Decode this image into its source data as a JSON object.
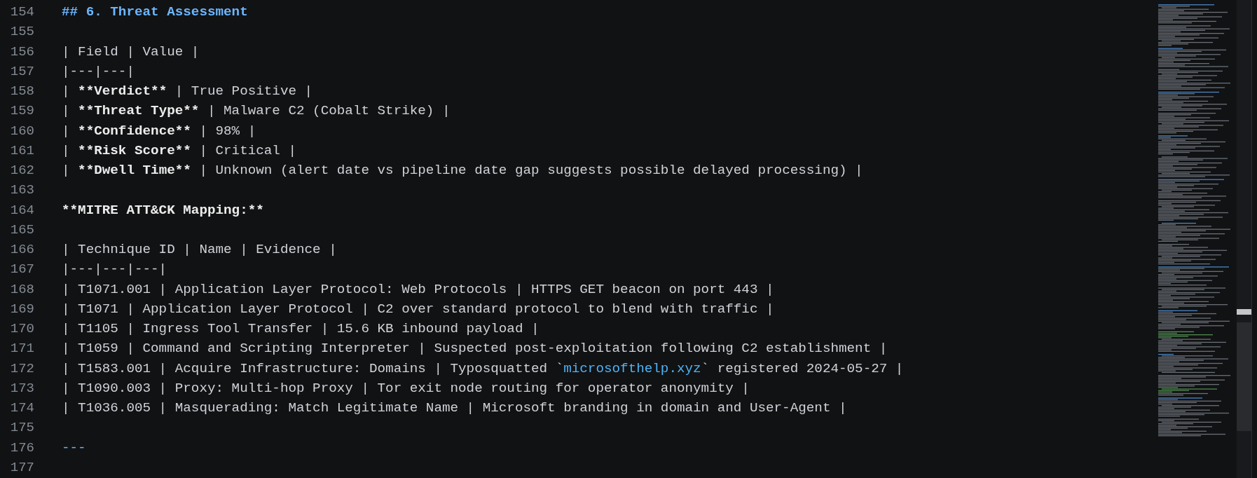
{
  "editor": {
    "lines": [
      {
        "number": "154",
        "segments": [
          {
            "kind": "heading",
            "text": "## 6. Threat Assessment"
          }
        ]
      },
      {
        "number": "155"
      },
      {
        "number": "156",
        "segments": [
          {
            "kind": "text",
            "text": "| Field | Value |"
          }
        ]
      },
      {
        "number": "157",
        "segments": [
          {
            "kind": "text",
            "text": "|---|---|"
          }
        ]
      },
      {
        "number": "158",
        "segments": [
          {
            "kind": "text",
            "text": "| "
          },
          {
            "kind": "bold",
            "text": "**Verdict**"
          },
          {
            "kind": "text",
            "text": " | True Positive |"
          }
        ]
      },
      {
        "number": "159",
        "segments": [
          {
            "kind": "text",
            "text": "| "
          },
          {
            "kind": "bold",
            "text": "**Threat Type**"
          },
          {
            "kind": "text",
            "text": " | Malware C2 (Cobalt Strike) |"
          }
        ]
      },
      {
        "number": "160",
        "segments": [
          {
            "kind": "text",
            "text": "| "
          },
          {
            "kind": "bold",
            "text": "**Confidence**"
          },
          {
            "kind": "text",
            "text": " | 98% |"
          }
        ]
      },
      {
        "number": "161",
        "segments": [
          {
            "kind": "text",
            "text": "| "
          },
          {
            "kind": "bold",
            "text": "**Risk Score**"
          },
          {
            "kind": "text",
            "text": " | Critical |"
          }
        ]
      },
      {
        "number": "162",
        "segments": [
          {
            "kind": "text",
            "text": "| "
          },
          {
            "kind": "bold",
            "text": "**Dwell Time**"
          },
          {
            "kind": "text",
            "text": " | Unknown (alert date vs pipeline date gap suggests possible delayed processing) |"
          }
        ]
      },
      {
        "number": "163"
      },
      {
        "number": "164",
        "segments": [
          {
            "kind": "bold",
            "text": "**MITRE ATT&CK Mapping:**"
          }
        ]
      },
      {
        "number": "165"
      },
      {
        "number": "166",
        "segments": [
          {
            "kind": "text",
            "text": "| Technique ID | Name | Evidence |"
          }
        ]
      },
      {
        "number": "167",
        "segments": [
          {
            "kind": "text",
            "text": "|---|---|---|"
          }
        ]
      },
      {
        "number": "168",
        "segments": [
          {
            "kind": "text",
            "text": "| T1071.001 | Application Layer Protocol: Web Protocols | HTTPS GET beacon on port 443 |"
          }
        ]
      },
      {
        "number": "169",
        "segments": [
          {
            "kind": "text",
            "text": "| T1071 | Application Layer Protocol | C2 over standard protocol to blend with traffic |"
          }
        ]
      },
      {
        "number": "170",
        "segments": [
          {
            "kind": "text",
            "text": "| T1105 | Ingress Tool Transfer | 15.6 KB inbound payload |"
          }
        ]
      },
      {
        "number": "171",
        "segments": [
          {
            "kind": "text",
            "text": "| T1059 | Command and Scripting Interpreter | Suspected post-exploitation following C2 establishment |"
          }
        ]
      },
      {
        "number": "172",
        "segments": [
          {
            "kind": "text",
            "text": "| T1583.001 | Acquire Infrastructure: Domains | Typosquatted `"
          },
          {
            "kind": "code",
            "text": "microsofthelp.xyz"
          },
          {
            "kind": "text",
            "text": "` registered 2024-05-27 |"
          }
        ]
      },
      {
        "number": "173",
        "segments": [
          {
            "kind": "text",
            "text": "| T1090.003 | Proxy: Multi-hop Proxy | Tor exit node routing for operator anonymity |"
          }
        ]
      },
      {
        "number": "174",
        "segments": [
          {
            "kind": "text",
            "text": "| T1036.005 | Masquerading: Match Legitimate Name | Microsoft branding in domain and User-Agent |"
          }
        ]
      },
      {
        "number": "175"
      },
      {
        "number": "176",
        "segments": [
          {
            "kind": "rule",
            "text": "---"
          }
        ]
      },
      {
        "number": "177"
      }
    ]
  }
}
